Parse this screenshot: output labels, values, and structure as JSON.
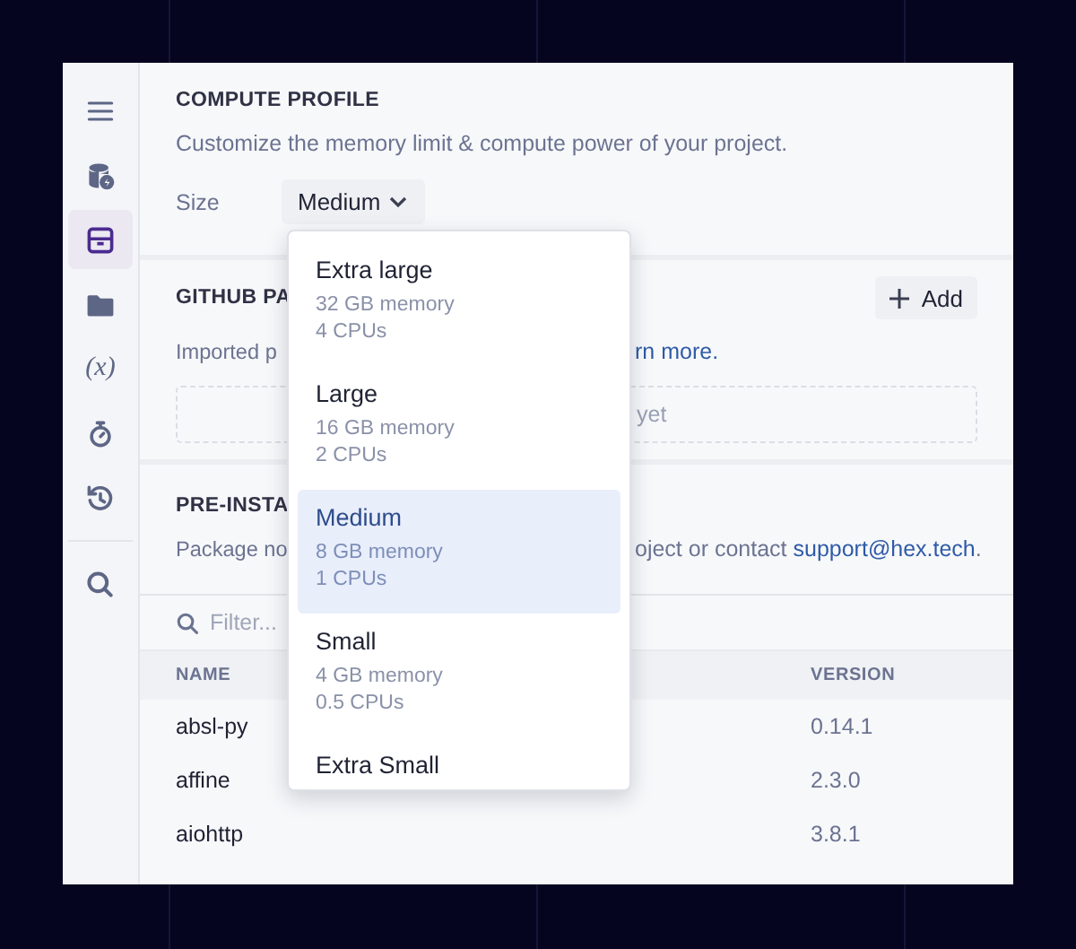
{
  "sidebar": {
    "items": [
      {
        "kind": "menu",
        "selected": false
      },
      {
        "kind": "database",
        "selected": false
      },
      {
        "kind": "package",
        "selected": true
      },
      {
        "kind": "folder",
        "selected": false
      },
      {
        "kind": "variable",
        "label": "(x)",
        "selected": false
      },
      {
        "kind": "timer",
        "selected": false
      },
      {
        "kind": "history",
        "selected": false
      },
      {
        "kind": "divider"
      },
      {
        "kind": "search",
        "selected": false
      }
    ]
  },
  "compute_profile": {
    "title": "COMPUTE PROFILE",
    "description": "Customize the memory limit & compute power of your project.",
    "size_label": "Size",
    "size_value": "Medium"
  },
  "github_packages": {
    "title": "GITHUB PA",
    "add_button": "Add",
    "description": "Imported p",
    "link": "rn more.",
    "empty_text": "yet"
  },
  "preinstalled": {
    "title": "PRE-INSTA",
    "description_start": "Package no",
    "description_end": "oject or contact ",
    "link": "support@hex.tech",
    "description_tail": ".",
    "filter_placeholder": "Filter...",
    "table": {
      "columns": [
        "NAME",
        "VERSION"
      ],
      "rows": [
        {
          "name": "absl-py",
          "version": "0.14.1"
        },
        {
          "name": "affine",
          "version": "2.3.0"
        },
        {
          "name": "aiohttp",
          "version": "3.8.1"
        }
      ]
    }
  },
  "size_menu": {
    "options": [
      {
        "name": "Extra large",
        "memory": "32 GB memory",
        "cpus": "4 CPUs",
        "selected": false
      },
      {
        "name": "Large",
        "memory": "16 GB memory",
        "cpus": "2 CPUs",
        "selected": false
      },
      {
        "name": "Medium",
        "memory": "8 GB memory",
        "cpus": "1 CPUs",
        "selected": true
      },
      {
        "name": "Small",
        "memory": "4 GB memory",
        "cpus": "0.5 CPUs",
        "selected": false
      },
      {
        "name": "Extra Small",
        "selected": false
      }
    ]
  }
}
